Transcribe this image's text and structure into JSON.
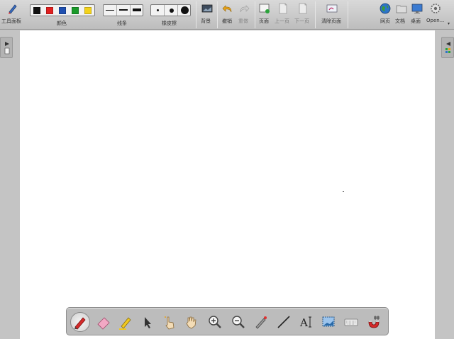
{
  "toolbar": {
    "tool_panel": "工具面板",
    "colors_label": "颜色",
    "colors": [
      "#111111",
      "#e02020",
      "#1f4fb0",
      "#1a9a2a",
      "#f3d21a"
    ],
    "lines_label": "线条",
    "eraser_label": "橡皮擦",
    "background": "背景",
    "undo": "撤销",
    "redo": "重做",
    "page": "页面",
    "prev_page": "上一页",
    "next_page": "下一页",
    "clear_page": "清除页面",
    "web": "网页",
    "document": "文档",
    "desktop": "桌面",
    "open": "Open..."
  },
  "dock": {
    "text_tool_label": "A"
  }
}
